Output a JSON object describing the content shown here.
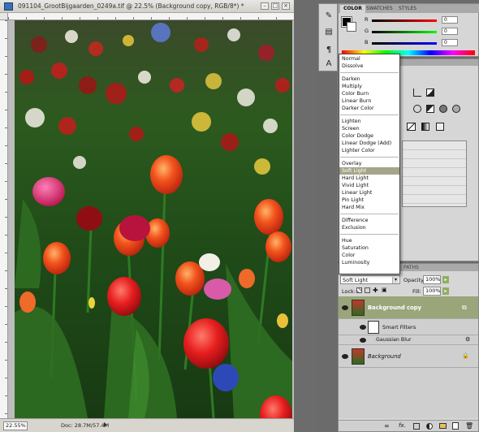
{
  "document": {
    "title": "091104_GrootBijgaarden_0249a.tif @ 22.5% (Background copy, RGB/8*) *",
    "zoom": "22.55%",
    "doc_size": "Doc: 28.7M/57.4M"
  },
  "color_panel": {
    "tabs": [
      "COLOR",
      "SWATCHES",
      "STYLES"
    ],
    "channels": [
      {
        "label": "R",
        "value": "0"
      },
      {
        "label": "G",
        "value": "0"
      },
      {
        "label": "B",
        "value": "0"
      }
    ]
  },
  "blend_menu": {
    "groups": [
      [
        "Normal",
        "Dissolve"
      ],
      [
        "Darken",
        "Multiply",
        "Color Burn",
        "Linear Burn",
        "Darker Color"
      ],
      [
        "Lighten",
        "Screen",
        "Color Dodge",
        "Linear Dodge (Add)",
        "Lighter Color"
      ],
      [
        "Overlay",
        "Soft Light",
        "Hard Light",
        "Vivid Light",
        "Linear Light",
        "Pin Light",
        "Hard Mix"
      ],
      [
        "Difference",
        "Exclusion"
      ],
      [
        "Hue",
        "Saturation",
        "Color",
        "Luminosity"
      ]
    ],
    "selected": "Soft Light"
  },
  "layers_panel": {
    "tab_label": "PATHS",
    "blend_mode": "Soft Light",
    "opacity_label": "Opacity:",
    "opacity_value": "100%",
    "lock_label": "Lock:",
    "fill_label": "Fill:",
    "fill_value": "100%",
    "layers": [
      {
        "name": "Background copy",
        "selected": true
      },
      {
        "name": "Smart Filters",
        "selected": false
      },
      {
        "name": "Gaussian Blur",
        "selected": false
      },
      {
        "name": "Background",
        "selected": false
      }
    ]
  },
  "colors": {
    "selection": "#a5a58a",
    "panel_bg": "#d6d6d6",
    "layer_selected": "#9aa57a"
  }
}
